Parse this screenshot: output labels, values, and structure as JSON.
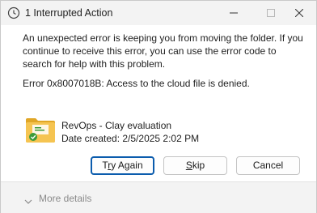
{
  "window": {
    "title": "1 Interrupted Action",
    "title_icon": "clock-icon",
    "controls": [
      "minimize-icon",
      "maximize-icon",
      "close-icon"
    ]
  },
  "message": {
    "body": "An unexpected error is keeping you from moving the folder. If you continue to receive this error, you can use the error code to search for help with this problem.",
    "error": "Error 0x8007018B: Access to the cloud file is denied."
  },
  "item": {
    "icon": "folder-icon",
    "name": "RevOps - Clay evaluation",
    "date": "Date created: 2/5/2025 2:02 PM"
  },
  "buttons": {
    "try_again": {
      "prefix": "T",
      "accel": "r",
      "rest": "y Again"
    },
    "skip": {
      "accel": "S",
      "rest": "kip"
    },
    "cancel": "Cancel"
  },
  "footer": {
    "more_details": "More details",
    "icon": "chevron-down-icon"
  },
  "colors": {
    "accent": "#0b5cad",
    "titlebar": "#f3f3f3",
    "folder": "#f5c451",
    "folder_dark": "#e0a626",
    "sync_badge": "#3a9b3a"
  }
}
